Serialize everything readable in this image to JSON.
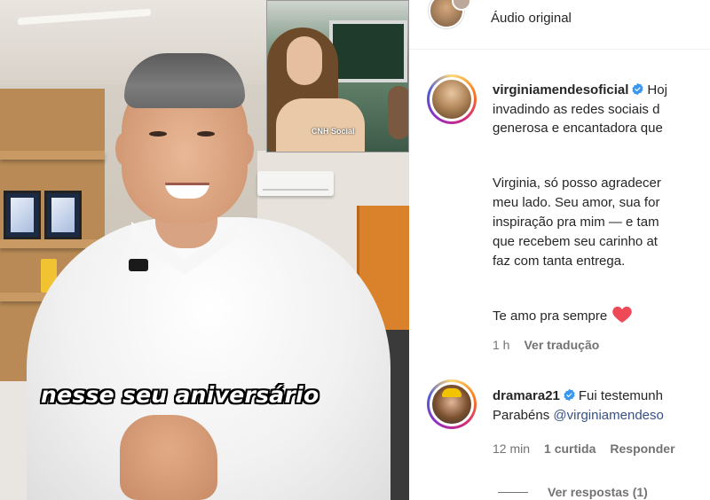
{
  "video": {
    "caption": "nesse seu aniversário",
    "inset_watermark": "CNH Social"
  },
  "header": {
    "audio_label": "Áudio original"
  },
  "comments": [
    {
      "username": "virginiamendesoficial",
      "verified": true,
      "lines": [
        "Hoj",
        "invadindo as redes sociais d",
        "generosa e encantadora que"
      ],
      "paragraph2": [
        "Virginia, só posso agradecer",
        "meu lado. Seu amor, sua for",
        "inspiração pra mim — e tam",
        "que recebem seu carinho at",
        "faz com tanta entrega."
      ],
      "closing": "Te amo pra sempre",
      "time": "1 h",
      "translate": "Ver tradução"
    },
    {
      "username": "dramara21",
      "verified": true,
      "first_line": "Fui testemunh",
      "second_line_prefix": "Parabéns ",
      "mention": "@virginiamendeso",
      "time": "12 min",
      "likes": "1 curtida",
      "reply": "Responder",
      "view_replies": "Ver respostas (1)"
    }
  ],
  "colors": {
    "verified_blue": "#3897f0",
    "heart_red": "#ed4956",
    "mention_blue": "#385185"
  }
}
